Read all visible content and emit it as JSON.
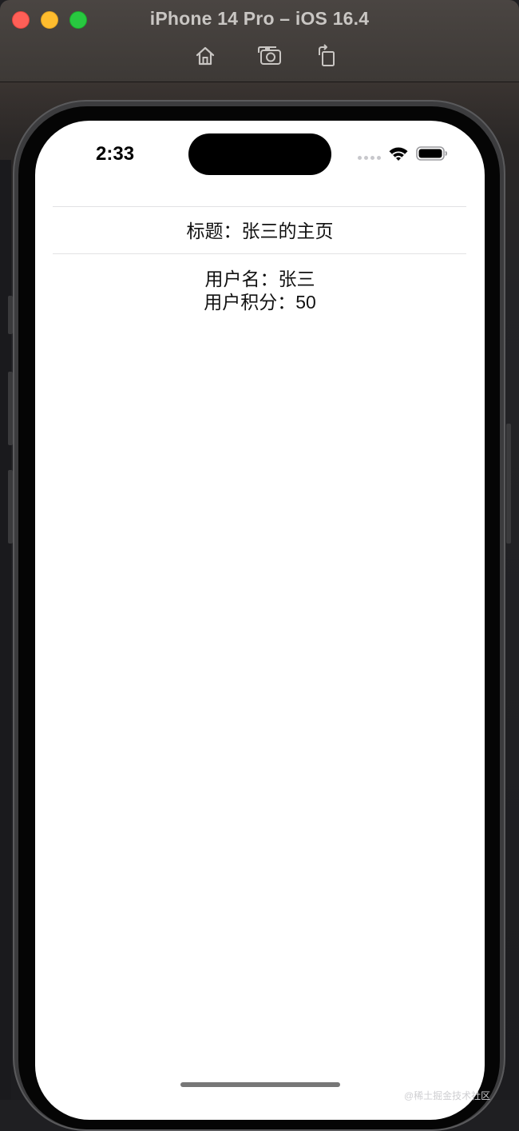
{
  "window": {
    "title": "iPhone 14 Pro – iOS 16.4",
    "toolbar": {
      "home_icon": "home-icon",
      "screenshot_icon": "camera-icon",
      "rotate_icon": "rotate-icon"
    }
  },
  "status_bar": {
    "time": "2:33"
  },
  "page": {
    "title": "标题：张三的主页",
    "username_line": "用户名：张三",
    "points_line": "用户积分：50"
  },
  "watermark": "@稀土掘金技术社区",
  "colors": {
    "close": "#ff5f57",
    "minimize": "#febc2e",
    "zoom": "#28c840"
  }
}
